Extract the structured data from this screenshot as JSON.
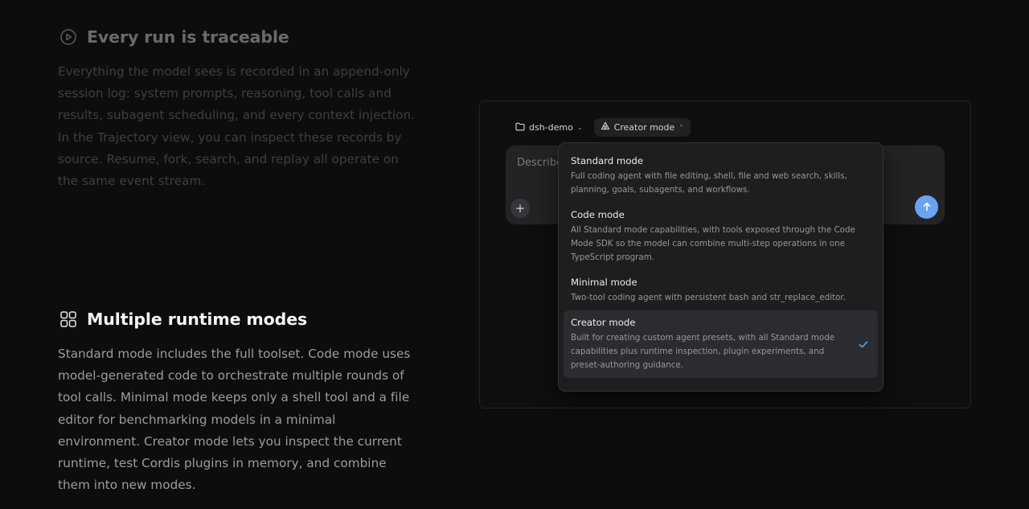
{
  "features": [
    {
      "title": "Every run is traceable",
      "icon": "play-circle-icon",
      "body": "Everything the model sees is recorded in an append-only session log: system prompts, reasoning, tool calls and results, subagent scheduling, and every context injection. In the Trajectory view, you can inspect these records by source. Resume, fork, search, and replay all operate on the same event stream."
    },
    {
      "title": "Multiple runtime modes",
      "icon": "grid-icon",
      "body": "Standard mode includes the full toolset. Code mode uses model-generated code to orchestrate multiple rounds of tool calls. Minimal mode keeps only a shell tool and a file editor for benchmarking models in a minimal environment. Creator mode lets you inspect the current runtime, test Cordis plugins in memory, and combine them into new modes."
    }
  ],
  "toolbar": {
    "project": "dsh-demo",
    "mode": "Creator mode"
  },
  "composer": {
    "placeholder": "Describe"
  },
  "modes": [
    {
      "label": "Standard mode",
      "desc": "Full coding agent with file editing, shell, file and web search, skills, planning, goals, subagents, and workflows."
    },
    {
      "label": "Code mode",
      "desc": "All Standard mode capabilities, with tools exposed through the Code Mode SDK so the model can combine multi-step operations in one TypeScript program."
    },
    {
      "label": "Minimal mode",
      "desc": "Two-tool coding agent with persistent bash and str_replace_editor."
    },
    {
      "label": "Creator mode",
      "desc": "Built for creating custom agent presets, with all Standard mode capabilities plus runtime inspection, plugin experiments, and preset-authoring guidance.",
      "selected": true
    }
  ],
  "colors": {
    "accent": "#6aa3f2",
    "background": "#0d0d0e",
    "menu": "#1e1e21"
  }
}
